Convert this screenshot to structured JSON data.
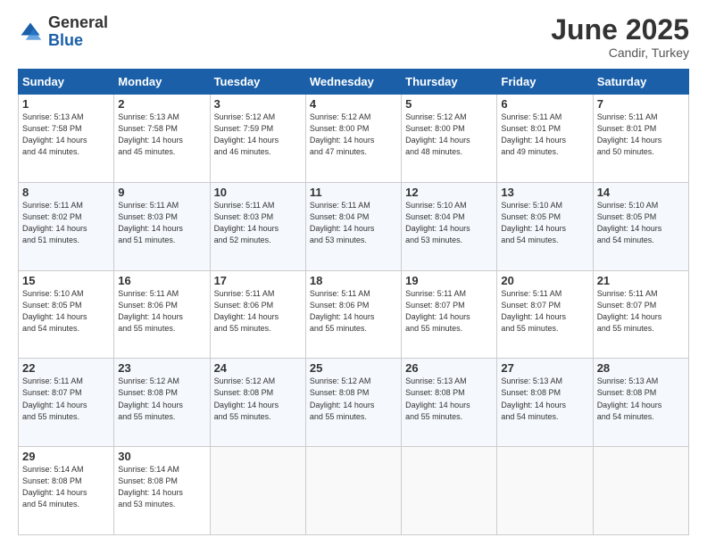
{
  "logo": {
    "general": "General",
    "blue": "Blue"
  },
  "header": {
    "month": "June 2025",
    "location": "Candir, Turkey"
  },
  "weekdays": [
    "Sunday",
    "Monday",
    "Tuesday",
    "Wednesday",
    "Thursday",
    "Friday",
    "Saturday"
  ],
  "weeks": [
    [
      {
        "day": "1",
        "info": "Sunrise: 5:13 AM\nSunset: 7:58 PM\nDaylight: 14 hours\nand 44 minutes."
      },
      {
        "day": "2",
        "info": "Sunrise: 5:13 AM\nSunset: 7:58 PM\nDaylight: 14 hours\nand 45 minutes."
      },
      {
        "day": "3",
        "info": "Sunrise: 5:12 AM\nSunset: 7:59 PM\nDaylight: 14 hours\nand 46 minutes."
      },
      {
        "day": "4",
        "info": "Sunrise: 5:12 AM\nSunset: 8:00 PM\nDaylight: 14 hours\nand 47 minutes."
      },
      {
        "day": "5",
        "info": "Sunrise: 5:12 AM\nSunset: 8:00 PM\nDaylight: 14 hours\nand 48 minutes."
      },
      {
        "day": "6",
        "info": "Sunrise: 5:11 AM\nSunset: 8:01 PM\nDaylight: 14 hours\nand 49 minutes."
      },
      {
        "day": "7",
        "info": "Sunrise: 5:11 AM\nSunset: 8:01 PM\nDaylight: 14 hours\nand 50 minutes."
      }
    ],
    [
      {
        "day": "8",
        "info": "Sunrise: 5:11 AM\nSunset: 8:02 PM\nDaylight: 14 hours\nand 51 minutes."
      },
      {
        "day": "9",
        "info": "Sunrise: 5:11 AM\nSunset: 8:03 PM\nDaylight: 14 hours\nand 51 minutes."
      },
      {
        "day": "10",
        "info": "Sunrise: 5:11 AM\nSunset: 8:03 PM\nDaylight: 14 hours\nand 52 minutes."
      },
      {
        "day": "11",
        "info": "Sunrise: 5:11 AM\nSunset: 8:04 PM\nDaylight: 14 hours\nand 53 minutes."
      },
      {
        "day": "12",
        "info": "Sunrise: 5:10 AM\nSunset: 8:04 PM\nDaylight: 14 hours\nand 53 minutes."
      },
      {
        "day": "13",
        "info": "Sunrise: 5:10 AM\nSunset: 8:05 PM\nDaylight: 14 hours\nand 54 minutes."
      },
      {
        "day": "14",
        "info": "Sunrise: 5:10 AM\nSunset: 8:05 PM\nDaylight: 14 hours\nand 54 minutes."
      }
    ],
    [
      {
        "day": "15",
        "info": "Sunrise: 5:10 AM\nSunset: 8:05 PM\nDaylight: 14 hours\nand 54 minutes."
      },
      {
        "day": "16",
        "info": "Sunrise: 5:11 AM\nSunset: 8:06 PM\nDaylight: 14 hours\nand 55 minutes."
      },
      {
        "day": "17",
        "info": "Sunrise: 5:11 AM\nSunset: 8:06 PM\nDaylight: 14 hours\nand 55 minutes."
      },
      {
        "day": "18",
        "info": "Sunrise: 5:11 AM\nSunset: 8:06 PM\nDaylight: 14 hours\nand 55 minutes."
      },
      {
        "day": "19",
        "info": "Sunrise: 5:11 AM\nSunset: 8:07 PM\nDaylight: 14 hours\nand 55 minutes."
      },
      {
        "day": "20",
        "info": "Sunrise: 5:11 AM\nSunset: 8:07 PM\nDaylight: 14 hours\nand 55 minutes."
      },
      {
        "day": "21",
        "info": "Sunrise: 5:11 AM\nSunset: 8:07 PM\nDaylight: 14 hours\nand 55 minutes."
      }
    ],
    [
      {
        "day": "22",
        "info": "Sunrise: 5:11 AM\nSunset: 8:07 PM\nDaylight: 14 hours\nand 55 minutes."
      },
      {
        "day": "23",
        "info": "Sunrise: 5:12 AM\nSunset: 8:08 PM\nDaylight: 14 hours\nand 55 minutes."
      },
      {
        "day": "24",
        "info": "Sunrise: 5:12 AM\nSunset: 8:08 PM\nDaylight: 14 hours\nand 55 minutes."
      },
      {
        "day": "25",
        "info": "Sunrise: 5:12 AM\nSunset: 8:08 PM\nDaylight: 14 hours\nand 55 minutes."
      },
      {
        "day": "26",
        "info": "Sunrise: 5:13 AM\nSunset: 8:08 PM\nDaylight: 14 hours\nand 55 minutes."
      },
      {
        "day": "27",
        "info": "Sunrise: 5:13 AM\nSunset: 8:08 PM\nDaylight: 14 hours\nand 54 minutes."
      },
      {
        "day": "28",
        "info": "Sunrise: 5:13 AM\nSunset: 8:08 PM\nDaylight: 14 hours\nand 54 minutes."
      }
    ],
    [
      {
        "day": "29",
        "info": "Sunrise: 5:14 AM\nSunset: 8:08 PM\nDaylight: 14 hours\nand 54 minutes."
      },
      {
        "day": "30",
        "info": "Sunrise: 5:14 AM\nSunset: 8:08 PM\nDaylight: 14 hours\nand 53 minutes."
      },
      null,
      null,
      null,
      null,
      null
    ]
  ]
}
